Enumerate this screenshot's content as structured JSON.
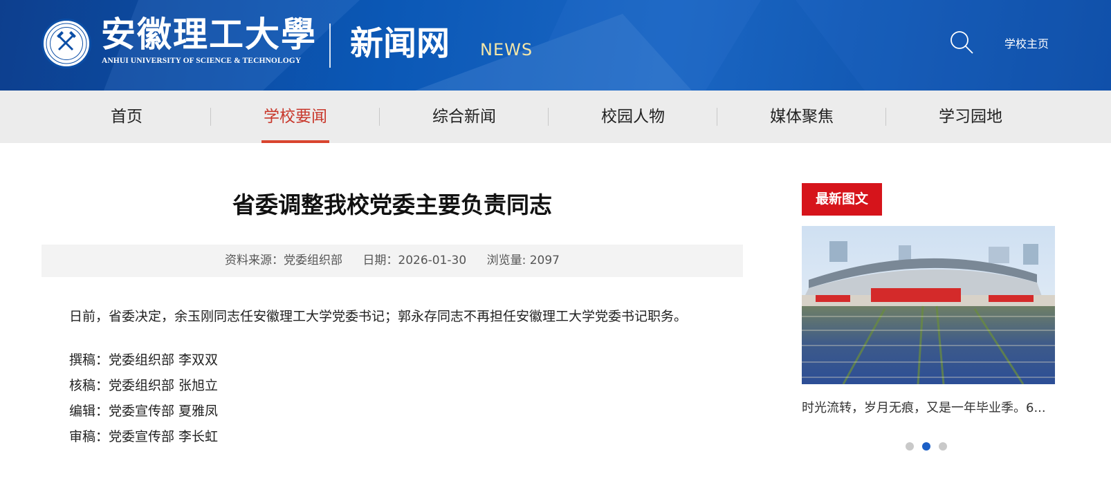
{
  "header": {
    "university_cn": "安徽理工大學",
    "university_en": "ANHUI UNIVERSITY OF SCIENCE & TECHNOLOGY",
    "site_cn": "新闻网",
    "site_en": "NEWS",
    "search_icon": "search-icon",
    "home_link": "学校主页"
  },
  "nav": {
    "items": [
      {
        "label": "首页"
      },
      {
        "label": "学校要闻"
      },
      {
        "label": "综合新闻"
      },
      {
        "label": "校园人物"
      },
      {
        "label": "媒体聚焦"
      },
      {
        "label": "学习园地"
      }
    ],
    "active_index": 1
  },
  "article": {
    "title": "省委调整我校党委主要负责同志",
    "source": "资料来源：党委组织部",
    "date": "日期：2026-01-30",
    "views": "浏览量: 2097",
    "paragraph": "日前，省委决定，余玉刚同志任安徽理工大学党委书记；郭永存同志不再担任安徽理工大学党委书记职务。",
    "credits": [
      "撰稿：党委组织部 李双双",
      "核稿：党委组织部 张旭立",
      "编辑：党委宣传部 夏雅凤",
      "审稿：党委宣传部 李长虹"
    ]
  },
  "sidebar": {
    "tag": "最新图文",
    "caption": "时光流转，岁月无痕，又是一年毕业季。6...",
    "carousel_total": 3,
    "carousel_active": 1
  },
  "colors": {
    "header_blue": "#0b58b6",
    "nav_bg": "#ececec",
    "accent_red": "#d6141b",
    "active_nav": "#c8372b",
    "dot_active": "#1b5fc6"
  }
}
